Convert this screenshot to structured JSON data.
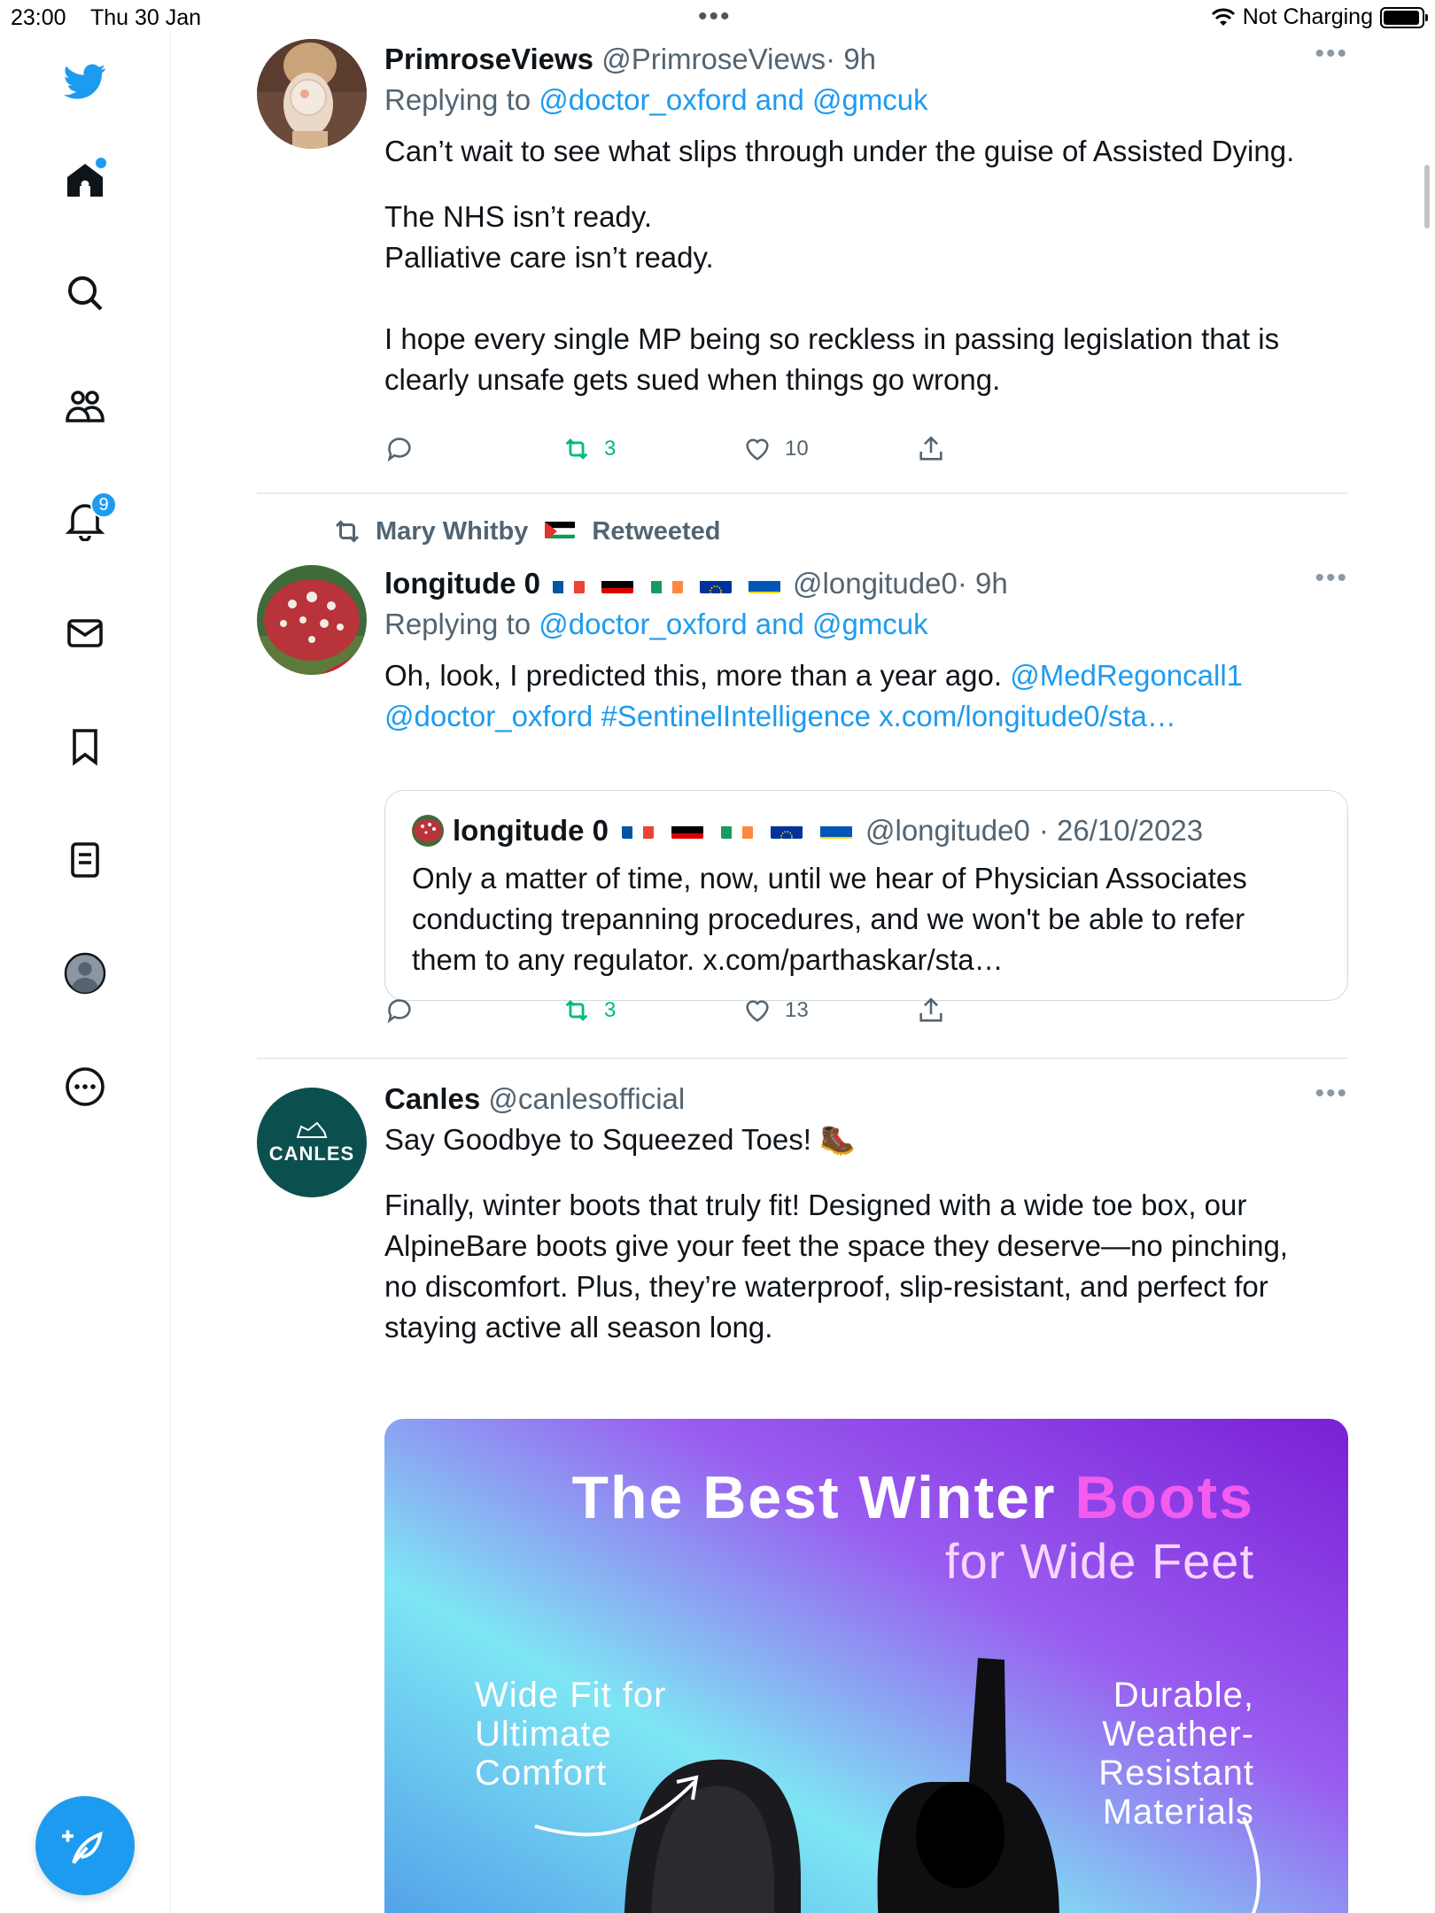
{
  "status": {
    "time": "23:00",
    "date": "Thu 30 Jan",
    "charging": "Not Charging"
  },
  "sidebar": {
    "notifications_badge": "9",
    "items": [
      "twitter-logo",
      "home",
      "explore",
      "communities",
      "notifications",
      "messages",
      "bookmarks",
      "lists",
      "profile",
      "more"
    ]
  },
  "tweets": [
    {
      "name": "PrimroseViews",
      "handle": "@PrimroseViews",
      "time": "· 9h",
      "replying_prefix": "Replying to",
      "replying_to": "@doctor_oxford and @gmcuk",
      "body": [
        "Can’t wait to see what slips through under the guise of Assisted Dying.",
        "",
        "The NHS isn’t ready.",
        "Palliative care isn’t ready.",
        "",
        "I hope every single MP being so reckless in passing legislation that is",
        "clearly unsafe gets sued when things go wrong."
      ],
      "retweets": "3",
      "likes": "10"
    },
    {
      "retweeted_by": "Mary Whitby",
      "retweeted_label": "Retweeted",
      "name": "longitude 0",
      "handle": "@longitude0",
      "time": "· 9h",
      "replying_prefix": "Replying to",
      "replying_to": "@doctor_oxford and @gmcuk",
      "body_line1": "Oh, look, I predicted this, more than a year ago. ",
      "mention1": "@MedRegoncall1",
      "body_line2": "@doctor_oxford #SentinelIntelligence x.com/longitude0/sta…",
      "quote": {
        "name": "longitude 0",
        "handle": "@longitude0",
        "time": "· 26/10/2023",
        "body": [
          "Only a matter of time, now, until we hear of Physician Associates",
          "conducting trepanning procedures, and we won't be able to refer",
          "them to any regulator. x.com/parthaskar/sta…"
        ]
      },
      "retweets": "3",
      "likes": "13"
    },
    {
      "name": "Canles",
      "handle": "@canlesofficial",
      "avatar_text": "CANLES",
      "headline": "Say Goodbye to Squeezed Toes! 🥾",
      "body": [
        "Finally, winter boots that truly fit! Designed with a wide toe box, our",
        "AlpineBare boots give your feet the space they deserve—no pinching,",
        "no discomfort. Plus, they’re waterproof, slip-resistant, and perfect for",
        "staying active all season long."
      ],
      "ad": {
        "title_white": "The Best Winter ",
        "title_pink": "Boots",
        "subtitle": "for Wide Feet",
        "left_text": [
          "Wide Fit for",
          "Ultimate",
          "Comfort"
        ],
        "right_text": [
          "Durable,",
          "Weather-",
          "Resistant",
          "Materials"
        ]
      }
    }
  ],
  "colors": {
    "accent": "#1d9bf0",
    "retweet_green": "#00ba7c",
    "secondary_text": "#536471",
    "canles_teal": "#0c4f4f"
  }
}
